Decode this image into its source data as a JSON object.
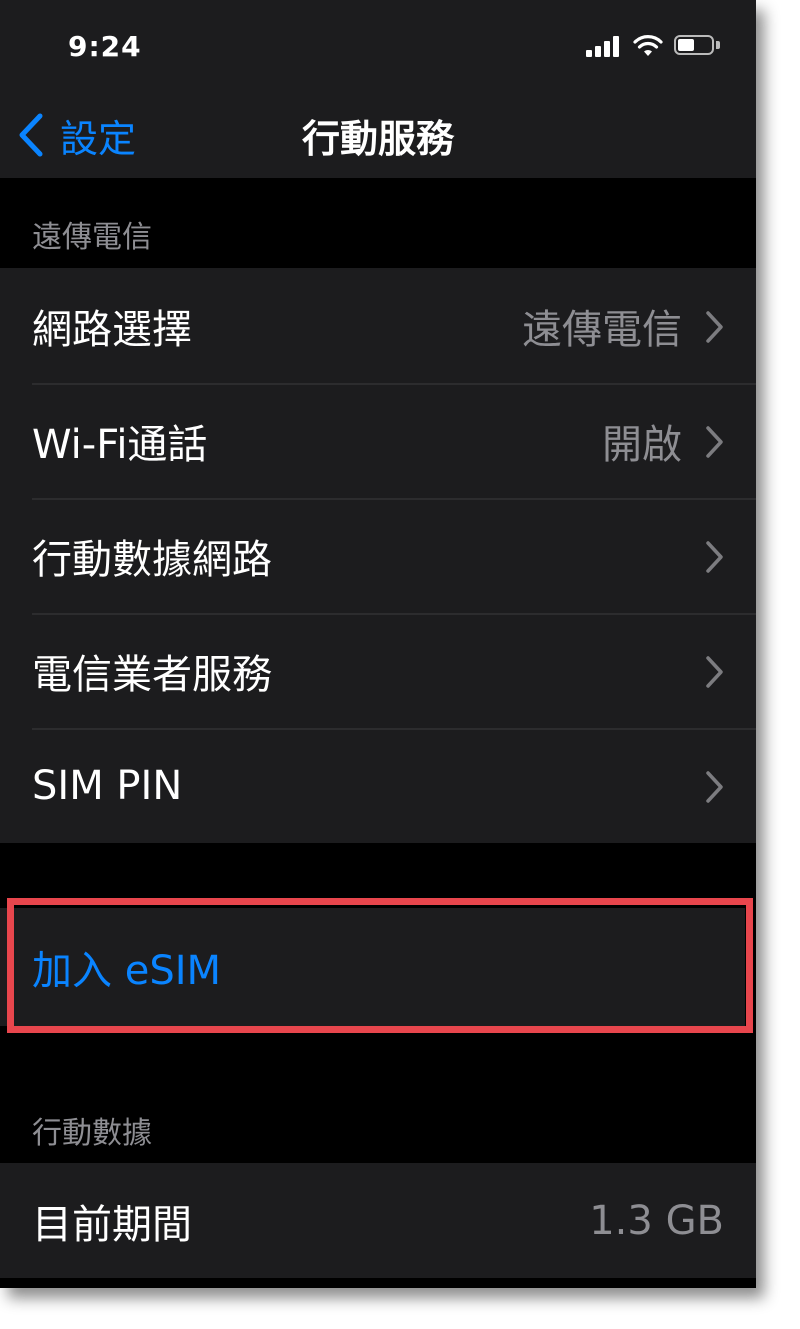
{
  "status_bar": {
    "time": "9:24",
    "icons": [
      "cellular-signal-icon",
      "wifi-icon",
      "battery-icon"
    ]
  },
  "nav": {
    "back_label": "設定",
    "title": "行動服務"
  },
  "carrier_section": {
    "header": "遠傳電信",
    "rows": [
      {
        "label": "網路選擇",
        "value": "遠傳電信"
      },
      {
        "label": "Wi-Fi通話",
        "value": "開啟"
      },
      {
        "label": "行動數據網路",
        "value": ""
      },
      {
        "label": "電信業者服務",
        "value": ""
      },
      {
        "label": "SIM PIN",
        "value": ""
      }
    ]
  },
  "esim": {
    "label": "加入 eSIM"
  },
  "data_section": {
    "header": "行動數據",
    "rows": [
      {
        "label": "目前期間",
        "value": "1.3 GB"
      }
    ]
  },
  "colors": {
    "accent": "#0a84ff",
    "highlight_border": "#e8464d",
    "background": "#000000",
    "cell_background": "#1c1c1e",
    "secondary_text": "#8e8e93"
  }
}
